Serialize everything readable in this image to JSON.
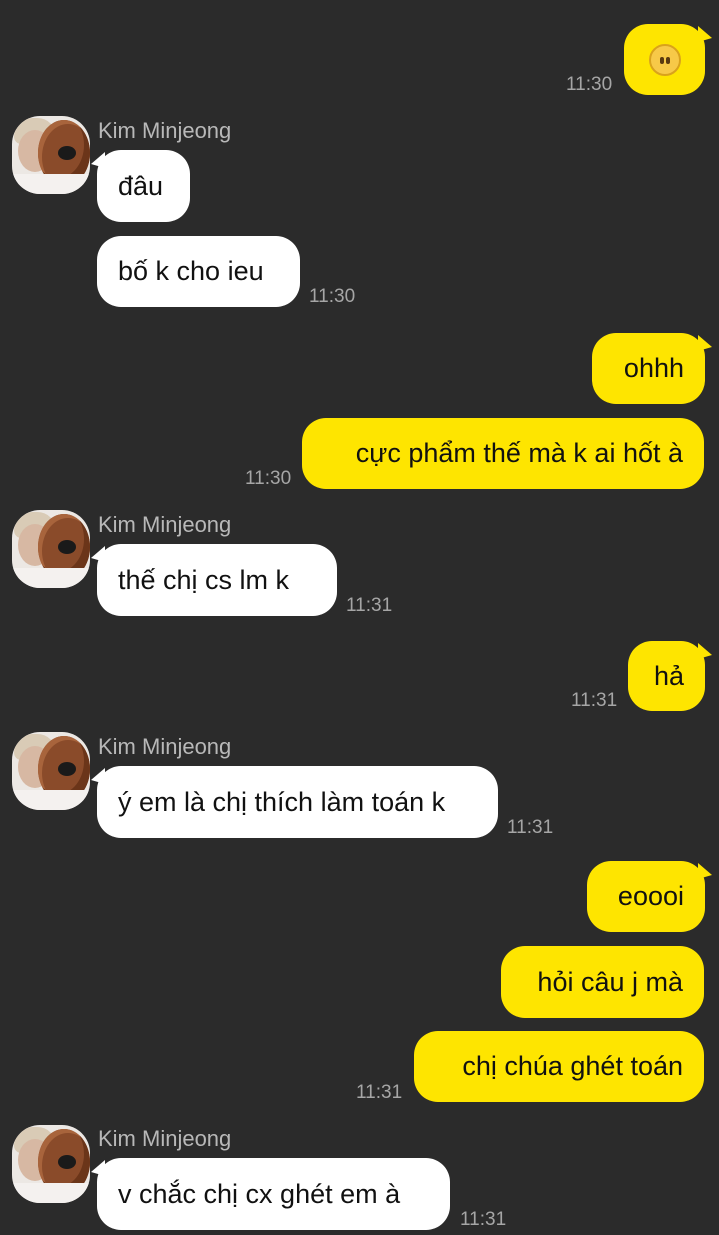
{
  "contact": {
    "name": "Kim Minjeong"
  },
  "messages": [
    {
      "side": "me",
      "emoji": "neutral-face-emoji",
      "time": "11:30"
    },
    {
      "side": "them",
      "text": "đâu"
    },
    {
      "side": "them",
      "text": "bố k cho ieu",
      "time": "11:30"
    },
    {
      "side": "me",
      "text": "ohhh"
    },
    {
      "side": "me",
      "text": "cực phẩm thế mà k ai hốt à",
      "time": "11:30"
    },
    {
      "side": "them",
      "text": "thế chị cs lm k",
      "time": "11:31"
    },
    {
      "side": "me",
      "text": "hả",
      "time": "11:31"
    },
    {
      "side": "them",
      "text": "ý em là chị thích làm toán k",
      "time": "11:31"
    },
    {
      "side": "me",
      "text": "eoooi"
    },
    {
      "side": "me",
      "text": "hỏi câu j mà"
    },
    {
      "side": "me",
      "text": "chị chúa ghét toán",
      "time": "11:31"
    },
    {
      "side": "them",
      "text": "v chắc chị cx ghét em à",
      "time": "11:31"
    }
  ],
  "colors": {
    "background": "#2b2b2b",
    "my_bubble": "#fee500",
    "their_bubble": "#ffffff"
  }
}
